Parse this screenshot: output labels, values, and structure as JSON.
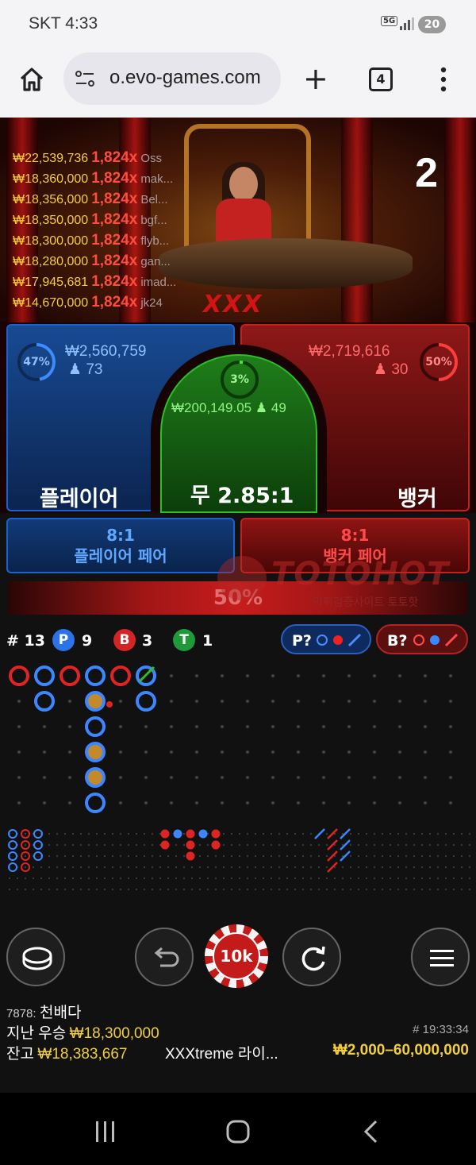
{
  "status_bar": {
    "carrier_time": "SKT 4:33",
    "network": "5G",
    "battery": "20"
  },
  "browser": {
    "url": "o.evo-games.com",
    "tab_count": "4"
  },
  "game": {
    "round_number": "2",
    "top_winners": [
      {
        "amount": "₩22,539,736",
        "multiplier": "1,824x",
        "name": "Oss"
      },
      {
        "amount": "₩18,360,000",
        "multiplier": "1,824x",
        "name": "mak..."
      },
      {
        "amount": "₩18,356,000",
        "multiplier": "1,824x",
        "name": "Bel..."
      },
      {
        "amount": "₩18,350,000",
        "multiplier": "1,824x",
        "name": "bgf..."
      },
      {
        "amount": "₩18,300,000",
        "multiplier": "1,824x",
        "name": "flyb..."
      },
      {
        "amount": "₩18,280,000",
        "multiplier": "1,824x",
        "name": "gan..."
      },
      {
        "amount": "₩17,945,681",
        "multiplier": "1,824x",
        "name": "imad..."
      },
      {
        "amount": "₩14,670,000",
        "multiplier": "1,824x",
        "name": "jk24"
      }
    ],
    "video_logo": "XXX",
    "player": {
      "percent": "47%",
      "percent_value": 47,
      "total": "₩2,560,759",
      "count": "73",
      "label": "플레이어"
    },
    "tie": {
      "percent": "3%",
      "percent_value": 3,
      "total": "₩200,149.05",
      "count": "49",
      "label": "무 2.85:1"
    },
    "banker": {
      "percent": "50%",
      "percent_value": 50,
      "total": "₩2,719,616",
      "count": "30",
      "label": "뱅커"
    },
    "player_pair": {
      "odds": "8:1",
      "label": "플레이어 페어"
    },
    "banker_pair": {
      "odds": "8:1",
      "label": "뱅커 페어"
    },
    "watermark": {
      "title": "TOTOHOT",
      "subtitle": "먹튀검증사이트 토토핫"
    },
    "progress": {
      "label": "50%",
      "value": 50
    },
    "stats": {
      "rounds": "# 13",
      "p_badge": "P",
      "p_count": "9",
      "b_badge": "B",
      "b_count": "3",
      "t_badge": "T",
      "t_count": "1",
      "player_ask": "P?",
      "banker_ask": "B?"
    },
    "chip_value": "10k",
    "info": {
      "table_id": "7878:",
      "dealer_name": "천배다",
      "last_win_label": "지난 우승",
      "last_win_amount": "₩18,300,000",
      "game_id": "# 19:33:34",
      "balance_label": "잔고",
      "balance_amount": "₩18,383,667",
      "table_name": "XXXtreme 라이...",
      "limits": "₩2,000–60,000,000"
    }
  },
  "colors": {
    "player": "#1a62d0",
    "banker": "#c42020",
    "tie": "#2fbe25",
    "gold": "#f2cf3a"
  }
}
